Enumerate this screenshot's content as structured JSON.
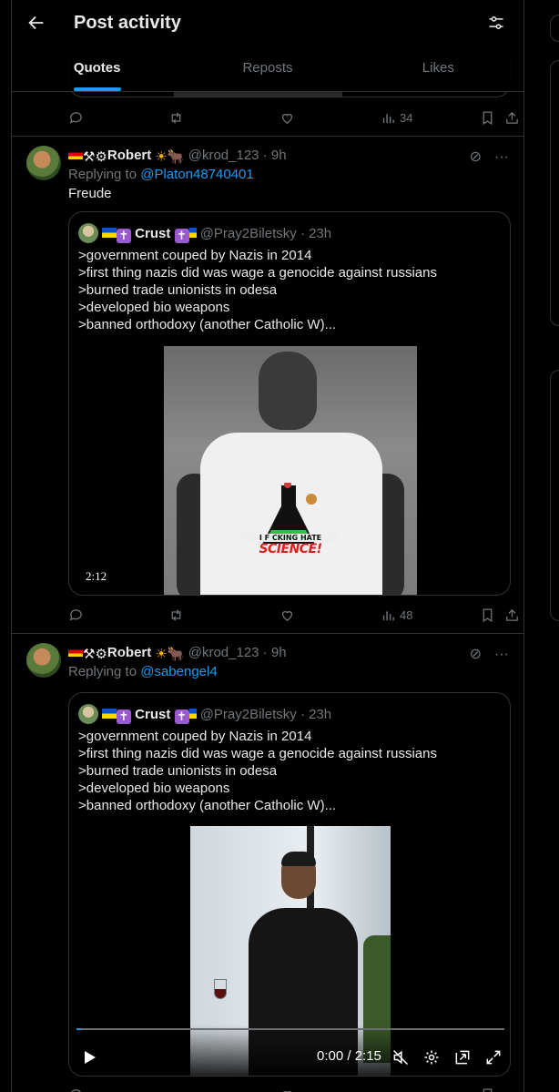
{
  "header": {
    "title": "Post activity",
    "tabs": [
      {
        "label": "Quotes",
        "active": true
      },
      {
        "label": "Reposts",
        "active": false
      },
      {
        "label": "Likes",
        "active": false
      }
    ]
  },
  "previous_post": {
    "views": "34"
  },
  "posts": [
    {
      "author_name": "Robert",
      "author_handle": "@krod_123",
      "time": "9h",
      "replying_prefix": "Replying to",
      "replying_to": "@Platon48740401",
      "text": "Freude",
      "quote": {
        "author_name": "Crust",
        "author_handle": "@Pray2Biletsky",
        "time": "23h",
        "lines": [
          ">government couped by Nazis in 2014",
          ">first thing nazis did was wage a genocide against russians",
          ">burned trade unionists in odesa",
          ">developed bio weapons",
          ">banned orthodoxy (another Catholic W)..."
        ],
        "media_logo_line1": "I F CKING HATE",
        "media_logo_line2": "SCIENCE!",
        "video_duration": "2:12"
      },
      "views": "48"
    },
    {
      "author_name": "Robert",
      "author_handle": "@krod_123",
      "time": "9h",
      "replying_prefix": "Replying to",
      "replying_to": "@sabengel4",
      "quote": {
        "author_name": "Crust",
        "author_handle": "@Pray2Biletsky",
        "time": "23h",
        "lines": [
          ">government couped by Nazis in 2014",
          ">first thing nazis did was wage a genocide against russians",
          ">burned trade unionists in odesa",
          ">developed bio weapons",
          ">banned orthodoxy (another Catholic W)..."
        ],
        "video_timecode": "0:00 / 2:15",
        "video_progress": 0.0
      }
    }
  ],
  "colors": {
    "background": "#000000",
    "text": "#e7e9ea",
    "muted": "#71767b",
    "accent": "#1d9bf0",
    "border": "#2f3336"
  },
  "icons": [
    "back-arrow-icon",
    "filter-icon",
    "reply-icon",
    "repost-icon",
    "like-icon",
    "views-icon",
    "bookmark-icon",
    "share-icon",
    "grok-icon",
    "more-icon",
    "play-icon",
    "mute-icon",
    "settings-icon",
    "pip-icon",
    "fullscreen-icon"
  ]
}
